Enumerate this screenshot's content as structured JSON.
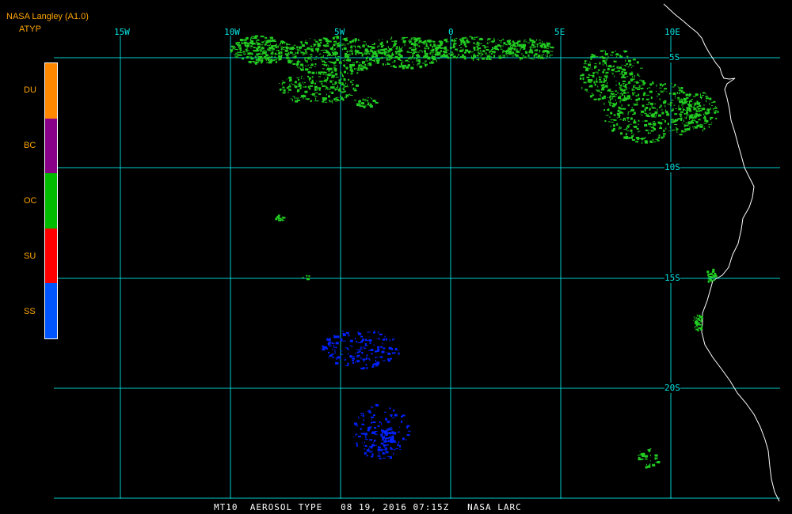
{
  "header": {
    "title": "NASA Langley (A1.0)",
    "product": "ATYP"
  },
  "legend": {
    "items": [
      {
        "label": "DU",
        "color": "#ff8800"
      },
      {
        "label": "BC",
        "color": "#880088"
      },
      {
        "label": "OC",
        "color": "#00bb00"
      },
      {
        "label": "SU",
        "color": "#ff0000"
      },
      {
        "label": "SS",
        "color": "#0055ff"
      }
    ]
  },
  "grid": {
    "longitude_labels": [
      "15W",
      "10W",
      "5W",
      "0",
      "5E",
      "10E"
    ],
    "latitude_labels": [
      "5S",
      "10S",
      "15S",
      "20S"
    ],
    "line_color": "#00cccc"
  },
  "footer": {
    "text": "MT10  AEROSOL TYPE   08 19, 2016 07:15Z   NASA LARC"
  },
  "colors": {
    "background": "#000000",
    "coastline": "#ffffff",
    "oc_pixels": "#22cc22",
    "ss_pixels": "#0022ff"
  }
}
